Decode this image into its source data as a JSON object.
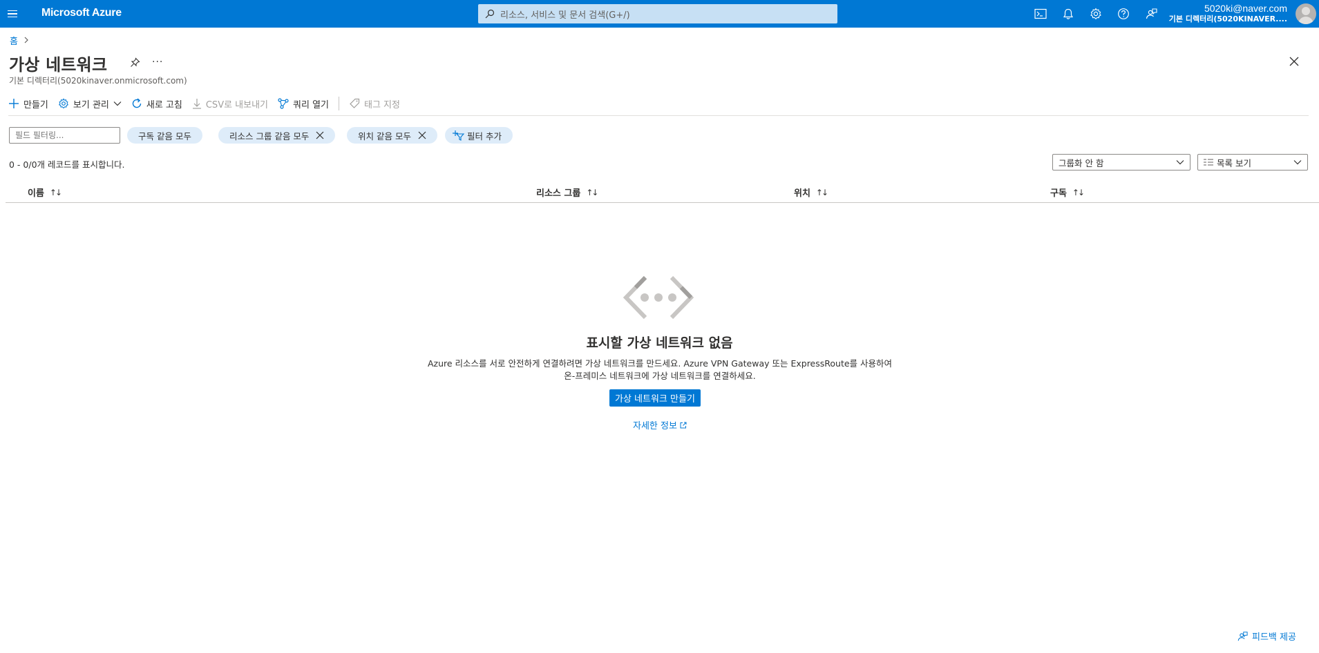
{
  "topbar": {
    "brand": "Microsoft Azure",
    "search_placeholder": "리소스, 서비스 및 문서 검색(G+/)",
    "account_email": "5020ki@naver.com",
    "account_directory": "기본 디렉터리(5020KINAVER....",
    "icons": [
      "cloud-shell-icon",
      "bell-icon",
      "gear-icon",
      "help-icon",
      "feedback-icon"
    ],
    "accent": "#0078d4"
  },
  "breadcrumb": {
    "home": "홈"
  },
  "page": {
    "title": "가상 네트워크",
    "subtitle": "기본 디렉터리(5020kinaver.onmicrosoft.com)",
    "more": "···"
  },
  "toolbar": {
    "create": "만들기",
    "manage_view": "보기 관리",
    "refresh": "새로 고침",
    "export_csv": "CSV로 내보내기",
    "open_query": "쿼리 열기",
    "assign_tags": "태그 지정"
  },
  "filters": {
    "field_filter_placeholder": "필드 필터링...",
    "subscription": "구독 같음 모두",
    "resource_group": "리소스 그룹 같음 모두",
    "location": "위치 같음 모두",
    "add_filter": "필터 추가"
  },
  "records": {
    "count_text": "0 - 0/0개 레코드를 표시합니다.",
    "grouping": "그룹화 안 함",
    "view_mode": "목록 보기"
  },
  "table": {
    "columns": [
      "이름",
      "리소스 그룹",
      "위치",
      "구독"
    ],
    "sort_name": "↑↓",
    "sort_other": "↑↓"
  },
  "empty_state": {
    "title": "표시할 가상 네트워크 없음",
    "description": "Azure 리소스를 서로 안전하게 연결하려면 가상 네트워크를 만드세요. Azure VPN Gateway 또는 ExpressRoute를 사용하여 온-프레미스 네트워크에 가상 네트워크를 연결하세요.",
    "create_button": "가상 네트워크 만들기",
    "more_info": "자세한 정보"
  },
  "footer": {
    "feedback": "피드백 제공"
  }
}
